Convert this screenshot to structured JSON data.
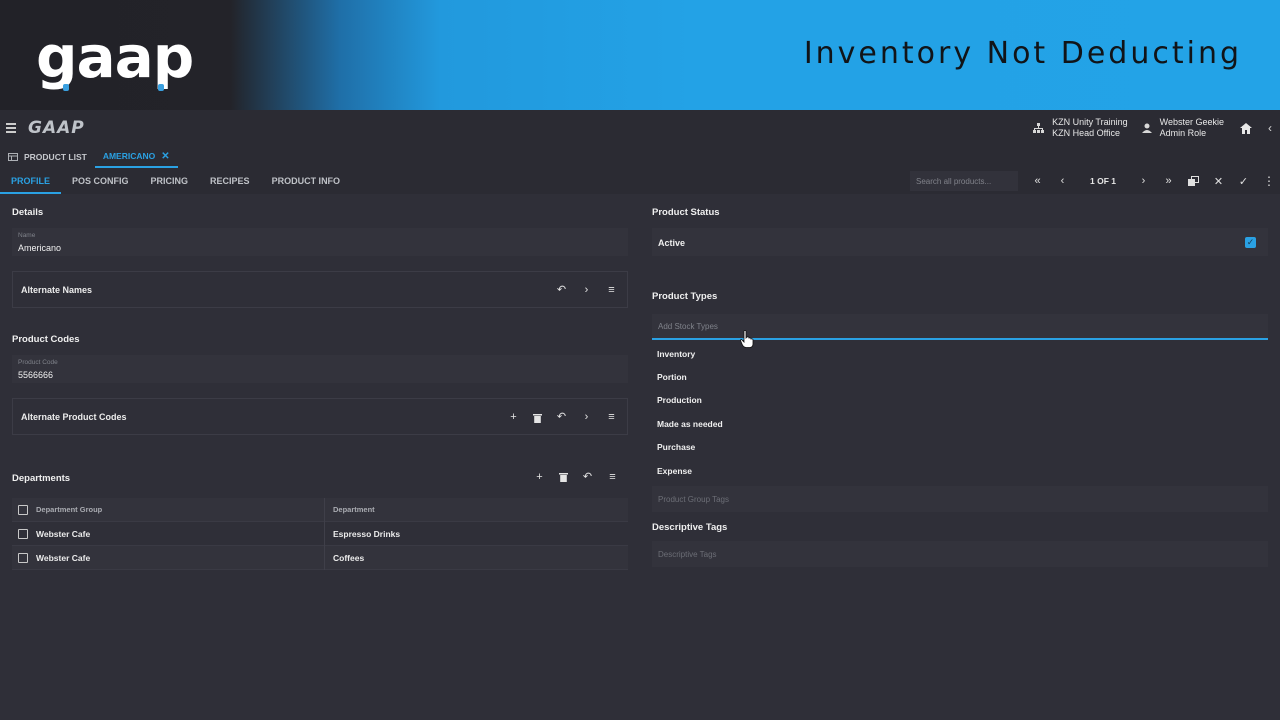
{
  "banner": {
    "logo_text": "gaap",
    "title": "Inventory Not Deducting"
  },
  "appbar": {
    "logo_text": "GAAP",
    "org_line1": "KZN Unity Training",
    "org_line2": "KZN Head Office",
    "user_line1": "Webster Geekie",
    "user_line2": "Admin Role"
  },
  "tabs": [
    {
      "label": "PRODUCT LIST",
      "icon": "table-icon"
    },
    {
      "label": "AMERICANO",
      "icon": "close-icon",
      "active": true
    }
  ],
  "subnav": {
    "items": [
      "PROFILE",
      "POS CONFIG",
      "PRICING",
      "RECIPES",
      "PRODUCT INFO"
    ],
    "active": "PROFILE",
    "search_placeholder": "Search all products...",
    "pager": "1 OF 1"
  },
  "details": {
    "title": "Details",
    "name_label": "Name",
    "name_value": "Americano",
    "alternate_names_label": "Alternate Names"
  },
  "product_codes": {
    "title": "Product Codes",
    "code_label": "Product Code",
    "code_value": "5566666",
    "alternate_codes_label": "Alternate Product Codes"
  },
  "departments": {
    "title": "Departments",
    "headers": [
      "Department Group",
      "Department"
    ],
    "rows": [
      [
        "Webster Cafe",
        "Espresso Drinks"
      ],
      [
        "Webster Cafe",
        "Coffees"
      ]
    ]
  },
  "product_status": {
    "title": "Product Status",
    "value": "Active",
    "checked": true
  },
  "product_types": {
    "title": "Product Types",
    "placeholder": "Add Stock Types",
    "options": [
      "Inventory",
      "Portion",
      "Production",
      "Made as needed",
      "Purchase",
      "Expense"
    ]
  },
  "group_tags": {
    "placeholder": "Product Group Tags"
  },
  "descriptive_tags": {
    "title": "Descriptive Tags",
    "placeholder": "Descriptive Tags"
  },
  "colors": {
    "accent": "#2aa1e3",
    "background": "#2f2f38",
    "banner_blue": "#23a3e7"
  }
}
